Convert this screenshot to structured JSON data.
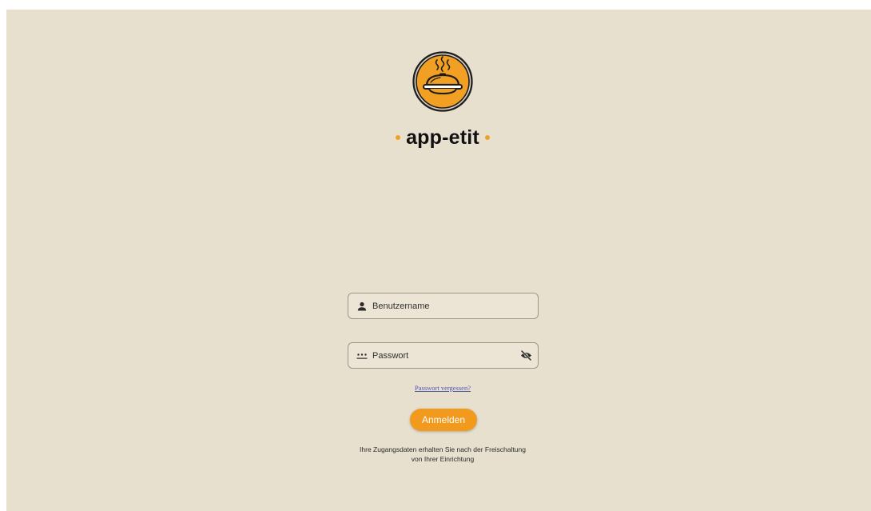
{
  "brand": {
    "name": "app-etit",
    "accent_color": "#f2a024",
    "background_color": "#e8e0cf",
    "logo_icon": "serving-dish-steam-icon"
  },
  "form": {
    "username": {
      "placeholder": "Benutzername",
      "value": "",
      "icon": "person-icon"
    },
    "password": {
      "placeholder": "Passwort",
      "value": "",
      "icon": "password-dots-icon",
      "toggle_icon": "eye-off-icon"
    },
    "forgot_link": "Passwort vergessen?",
    "submit_label": "Anmelden",
    "submit_color": "#f29a1d",
    "info_line1": "Ihre Zugangsdaten erhalten Sie nach der Freischaltung",
    "info_line2": "von Ihrer Einrichtung"
  }
}
